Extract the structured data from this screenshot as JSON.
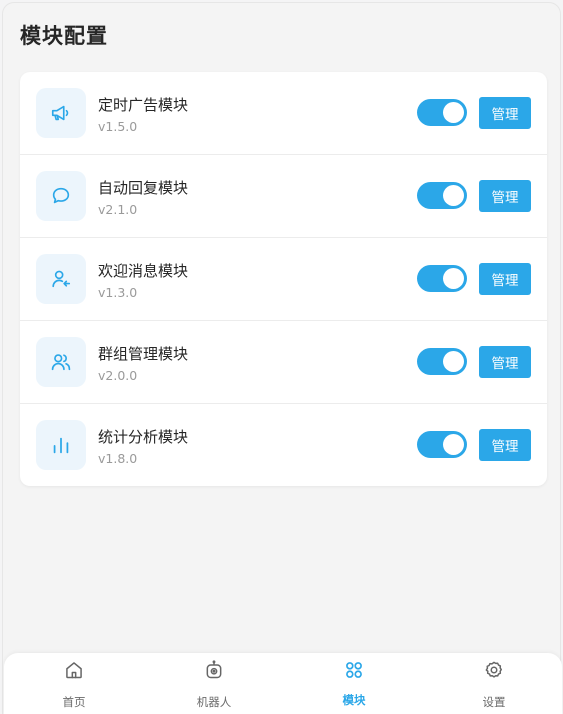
{
  "header": {
    "title": "模块配置"
  },
  "modules": [
    {
      "name": "定时广告模块",
      "version": "v1.5.0",
      "icon": "megaphone-icon",
      "enabled": true,
      "manage_label": "管理"
    },
    {
      "name": "自动回复模块",
      "version": "v2.1.0",
      "icon": "chat-bubble-icon",
      "enabled": true,
      "manage_label": "管理"
    },
    {
      "name": "欢迎消息模块",
      "version": "v1.3.0",
      "icon": "user-join-icon",
      "enabled": true,
      "manage_label": "管理"
    },
    {
      "name": "群组管理模块",
      "version": "v2.0.0",
      "icon": "users-icon",
      "enabled": true,
      "manage_label": "管理"
    },
    {
      "name": "统计分析模块",
      "version": "v1.8.0",
      "icon": "bar-chart-icon",
      "enabled": true,
      "manage_label": "管理"
    }
  ],
  "nav": {
    "items": [
      {
        "label": "首页",
        "icon": "home-icon",
        "active": false
      },
      {
        "label": "机器人",
        "icon": "robot-icon",
        "active": false
      },
      {
        "label": "模块",
        "icon": "modules-icon",
        "active": true
      },
      {
        "label": "设置",
        "icon": "gear-icon",
        "active": false
      }
    ]
  },
  "colors": {
    "accent": "#2ba7e8",
    "icon_bg": "#ecf5fc",
    "page_bg": "#f4f4f4"
  }
}
